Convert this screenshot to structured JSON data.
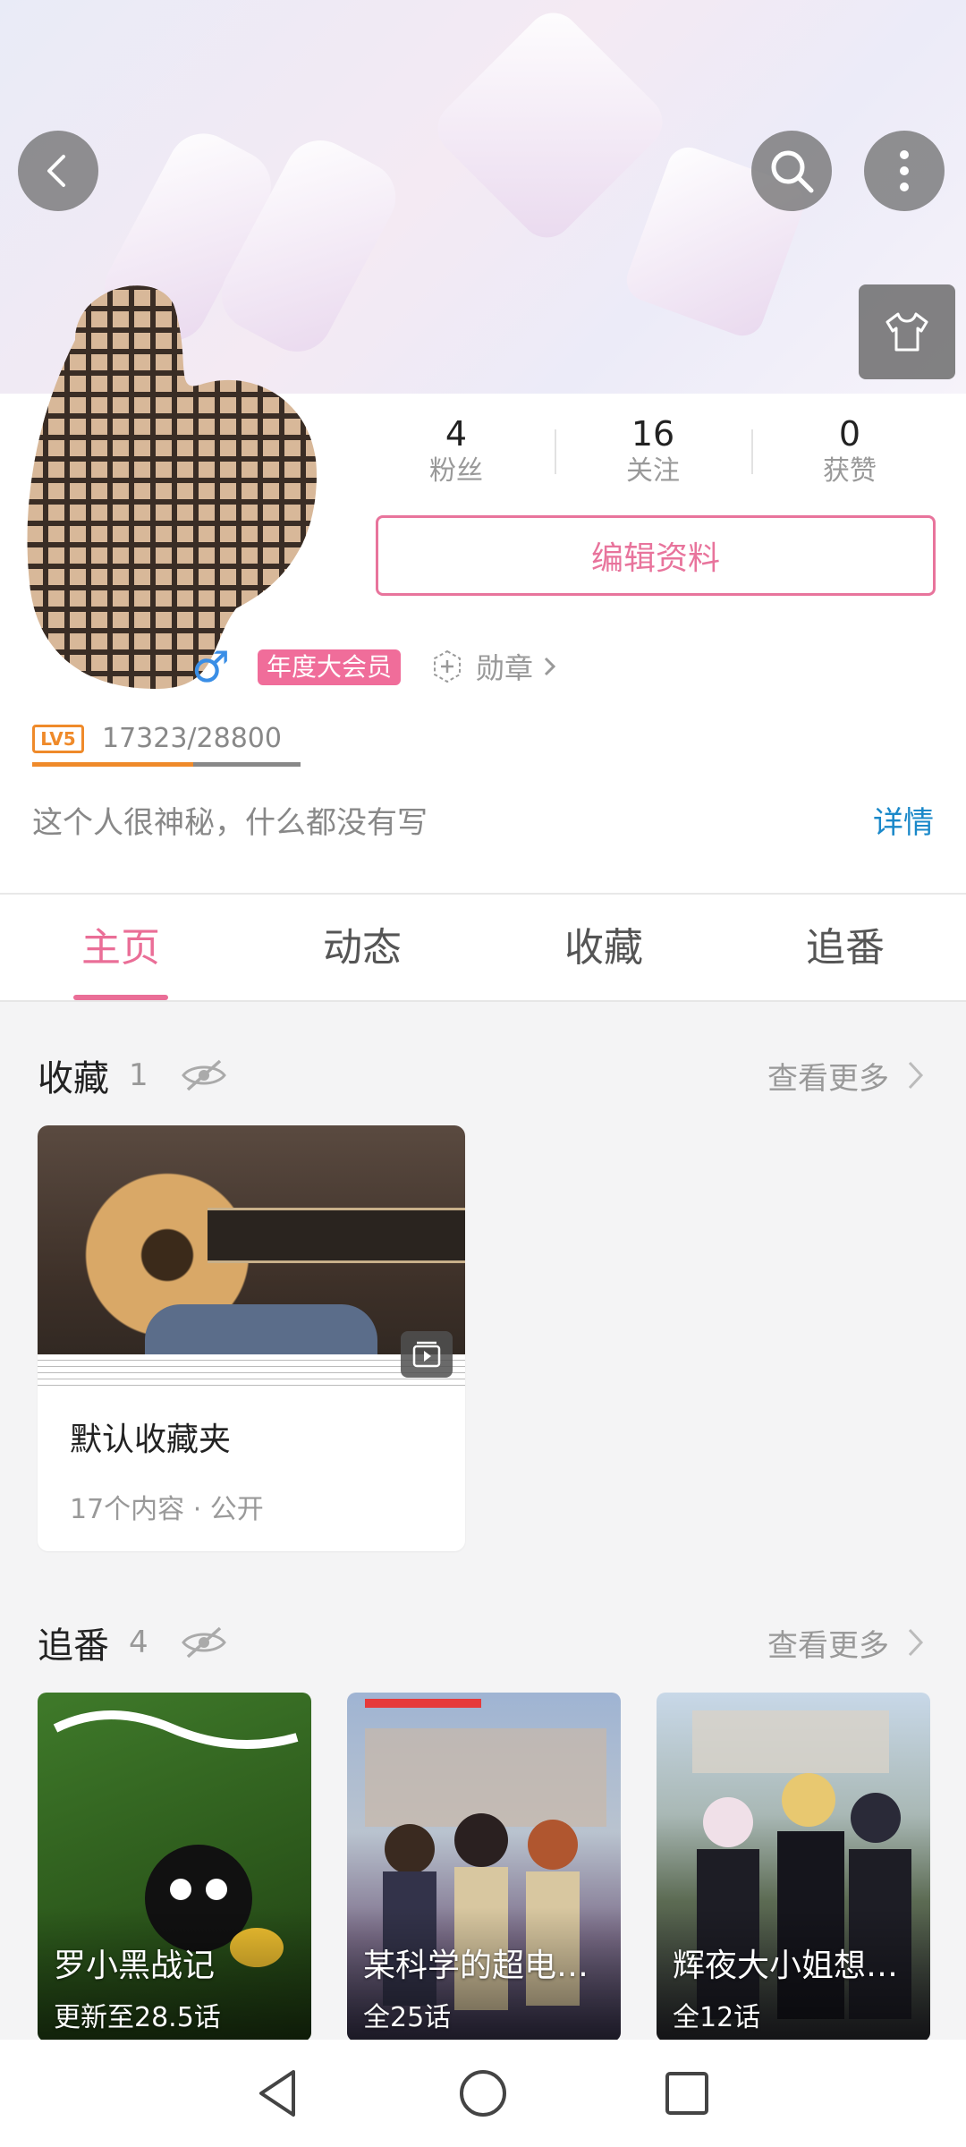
{
  "header": {
    "back_icon": "back-arrow-icon",
    "search_icon": "search-icon",
    "more_icon": "more-vertical-icon",
    "theme_icon": "shirt-icon"
  },
  "profile": {
    "stats": [
      {
        "value": "4",
        "label": "粉丝"
      },
      {
        "value": "16",
        "label": "关注"
      },
      {
        "value": "0",
        "label": "获赞"
      }
    ],
    "edit_label": "编辑资料",
    "gender": "♂",
    "vip_label": "年度大会员",
    "medal_label": "勋章",
    "level_badge": "LV5",
    "level_exp": "17323/28800",
    "level_progress": 0.6015,
    "signature": "这个人很神秘，什么都没有写",
    "detail_label": "详情"
  },
  "tabs": [
    {
      "label": "主页",
      "active": true
    },
    {
      "label": "动态",
      "active": false
    },
    {
      "label": "收藏",
      "active": false
    },
    {
      "label": "追番",
      "active": false
    }
  ],
  "favorites": {
    "title": "收藏",
    "count": "1",
    "more_label": "查看更多",
    "card": {
      "name": "默认收藏夹",
      "meta": "17个内容 · 公开"
    }
  },
  "bangumi": {
    "title": "追番",
    "count": "4",
    "more_label": "查看更多",
    "items": [
      {
        "title": "罗小黑战记",
        "sub": "更新至28.5话"
      },
      {
        "title": "某科学的超电磁炮",
        "sub": "全25话"
      },
      {
        "title": "辉夜大小姐想让我告白？",
        "sub": "全12话"
      }
    ]
  },
  "colors": {
    "accent_pink": "#ea6e97",
    "link_blue": "#1a88c9",
    "level_orange": "#ef8a2a"
  }
}
